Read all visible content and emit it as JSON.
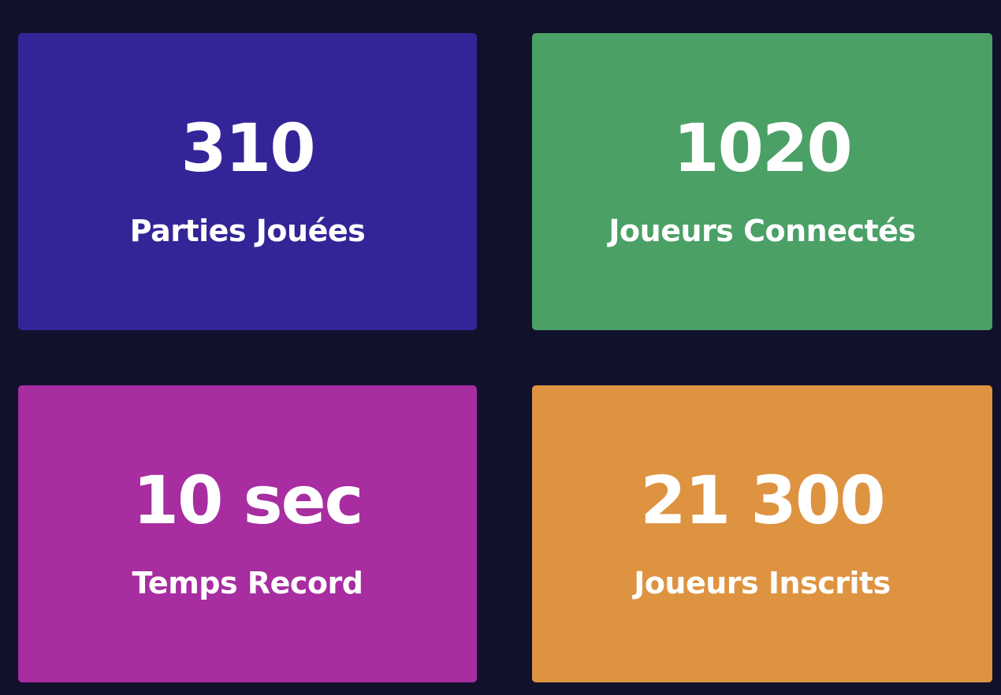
{
  "stats": [
    {
      "value": "310",
      "label": "Parties Jouées",
      "color": "#332598"
    },
    {
      "value": "1020",
      "label": "Joueurs Connectés",
      "color": "#4ba066"
    },
    {
      "value": "10 sec",
      "label": "Temps Record",
      "color": "#a72da0"
    },
    {
      "value": "21 300",
      "label": "Joueurs Inscrits",
      "color": "#de9340"
    }
  ],
  "colors": {
    "background": "#11112c",
    "text": "#ffffff"
  }
}
